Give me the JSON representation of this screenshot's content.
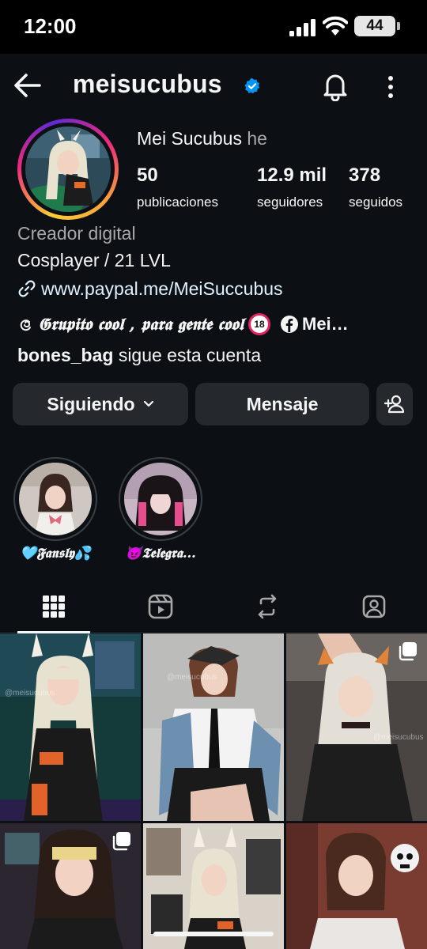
{
  "status_bar": {
    "time": "12:00",
    "battery": "44"
  },
  "header": {
    "username": "meisucubus"
  },
  "profile": {
    "display_name": "Mei Sucubus",
    "pronouns": "he",
    "stats": [
      {
        "value": "50",
        "label": "publicaciones"
      },
      {
        "value": "12.9 mil",
        "label": "seguidores"
      },
      {
        "value": "378",
        "label": "seguidos"
      }
    ],
    "category": "Creador digital",
    "bio": "Cosplayer / 21 LVL",
    "link": "www.paypal.me/MeiSuccubus",
    "threads_text": "𝕲𝖗𝖚𝖕𝖎𝖙𝖔 𝖈𝖔𝖔𝖑 , 𝖕𝖆𝖗𝖆 𝖌𝖊𝖓𝖙𝖊 𝖈𝖔𝖔𝖑",
    "age_badge": "18",
    "facebook_text": "Mei…",
    "followed_by_user": "bones_bag",
    "followed_by_text": "sigue esta cuenta"
  },
  "buttons": {
    "following": "Siguiendo",
    "message": "Mensaje"
  },
  "highlights": [
    {
      "label": "🩵𝕱𝖆𝖓𝖘𝖑𝖞💦"
    },
    {
      "label": "😈𝕿𝖊𝖑𝖊𝖌𝖗𝖆…"
    }
  ],
  "tabs": [
    "posts-grid",
    "reels",
    "reposts",
    "tagged"
  ],
  "grid": {
    "watermarks": [
      "@meisucubus",
      "@meisucubus",
      "@meisucubus",
      "@meisucubus"
    ]
  },
  "colors": {
    "background": "#0c1014",
    "button": "#25292e",
    "link": "#e0f1ff",
    "verified": "#0095f6"
  }
}
